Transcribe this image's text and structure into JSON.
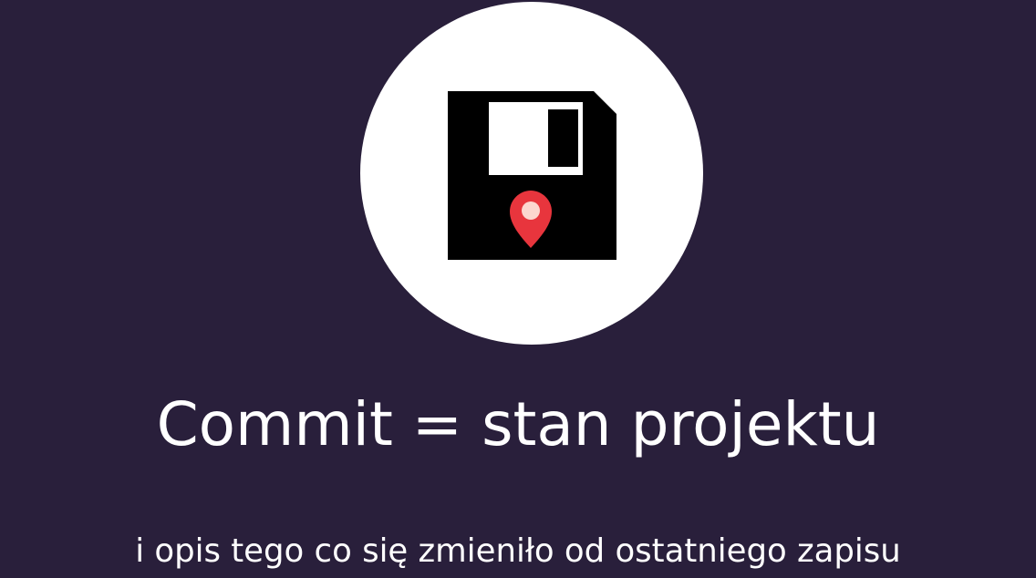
{
  "slide": {
    "icon": "floppy-disk-with-location-pin-icon",
    "title": "Commit = stan projektu",
    "subtitle": "i opis tego co się zmieniło od ostatniego zapisu"
  },
  "colors": {
    "background": "#291f3b",
    "circle": "#ffffff",
    "disk": "#000000",
    "pin": "#e8353d",
    "pin_center": "#fcd6cf",
    "text": "#ffffff"
  }
}
